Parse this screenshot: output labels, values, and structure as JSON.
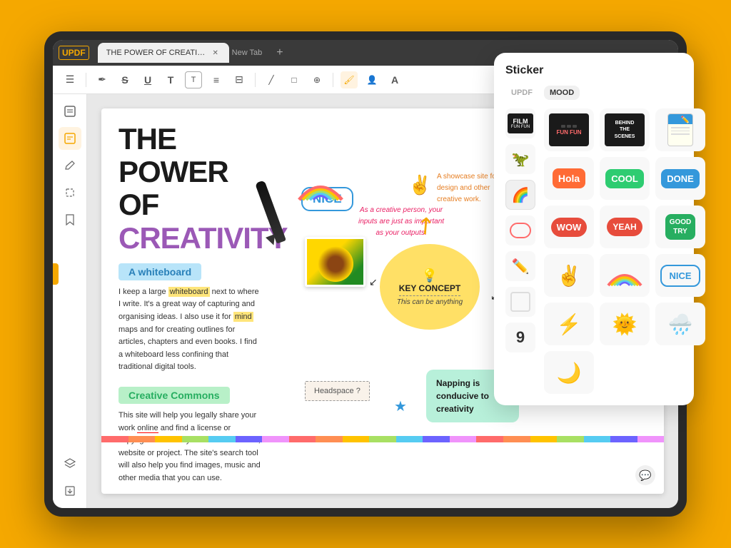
{
  "background": "#F5A800",
  "tablet": {
    "tab_label": "THE POWER OF CREATIVITY",
    "tab_new_label": "New Tab",
    "app_logo": "UPDF"
  },
  "toolbar": {
    "icons": [
      "☰",
      "✒",
      "S",
      "U",
      "T",
      "T",
      "≡",
      "≡",
      "/",
      "□",
      "⊕",
      "🖌",
      "👤",
      "A"
    ]
  },
  "sidebar": {
    "icons": [
      "⊞",
      "✏",
      "📋",
      "🔲",
      "📄",
      "🌐"
    ]
  },
  "doc": {
    "title_line1": "THE POWER OF",
    "title_line2": "CREATIVITY",
    "section1_heading": "A whiteboard",
    "section1_text": "I keep a large whiteboard next to where I write. It's a great way of capturing and organising ideas. I also use it for mind maps and for creating outlines for articles, chapters and even books. I find a whiteboard less confining that traditional digital tools.",
    "section2_heading": "Creative Commons",
    "section2_text": "This site will help you legally share your work online and find a license or copyright that suits your business model, website or project. The site's search tool will also help you find images, music and other media that you can use.",
    "nice_sticker": "NICE",
    "creative_text": "As a creative person, your\ninputs are just as important\nas your outputs.",
    "showcase_text": "A showcase site for\ndesign and other\ncreative work.",
    "key_concept_title": "KEY CONCEPT",
    "key_concept_sub": "This can be anything",
    "napping_text": "Napping is conducive\nto creativity",
    "headspace_text": "Headspace ?",
    "color_bar": [
      "#FF6B6B",
      "#FF8E53",
      "#FFC300",
      "#A8E063",
      "#56CCF2",
      "#6C63FF",
      "#F093FB",
      "#FF6B6B",
      "#FF8E53",
      "#FFC300",
      "#A8E063",
      "#56CCF2",
      "#6C63FF",
      "#F093FB",
      "#FF6B6B",
      "#FF8E53",
      "#FFC300",
      "#A8E063"
    ]
  },
  "sticker_panel": {
    "title": "Sticker",
    "tabs": [
      {
        "label": "UPDF",
        "active": false
      },
      {
        "label": "MOOD",
        "active": true
      }
    ],
    "categories": [
      {
        "icon": "🎬",
        "active": false
      },
      {
        "icon": "🦖",
        "active": false
      },
      {
        "icon": "🌈",
        "active": false
      },
      {
        "icon": "💬",
        "active": false
      },
      {
        "icon": "✏️",
        "active": false
      },
      {
        "icon": "⬜",
        "active": false
      },
      {
        "icon": "9️⃣",
        "active": false
      }
    ],
    "stickers": [
      {
        "type": "film",
        "label": "FILM"
      },
      {
        "type": "behind",
        "label": "BEHIND THE SCENES"
      },
      {
        "type": "notebook",
        "label": "📓"
      },
      {
        "type": "hola",
        "label": "Hola"
      },
      {
        "type": "cool",
        "label": "COOL"
      },
      {
        "type": "done",
        "label": "DONE"
      },
      {
        "type": "wow",
        "label": "WOW"
      },
      {
        "type": "yeah",
        "label": "YEAH"
      },
      {
        "type": "goodtry",
        "label": "GOOD TRY"
      },
      {
        "type": "peace",
        "label": "✌️"
      },
      {
        "type": "rainbow",
        "label": "🌈"
      },
      {
        "type": "nice_s",
        "label": "NICE"
      },
      {
        "type": "lightning",
        "label": "⚡"
      },
      {
        "type": "sun",
        "label": "🌞"
      },
      {
        "type": "rain",
        "label": "🌧"
      },
      {
        "type": "moon",
        "label": "🌙"
      }
    ]
  }
}
